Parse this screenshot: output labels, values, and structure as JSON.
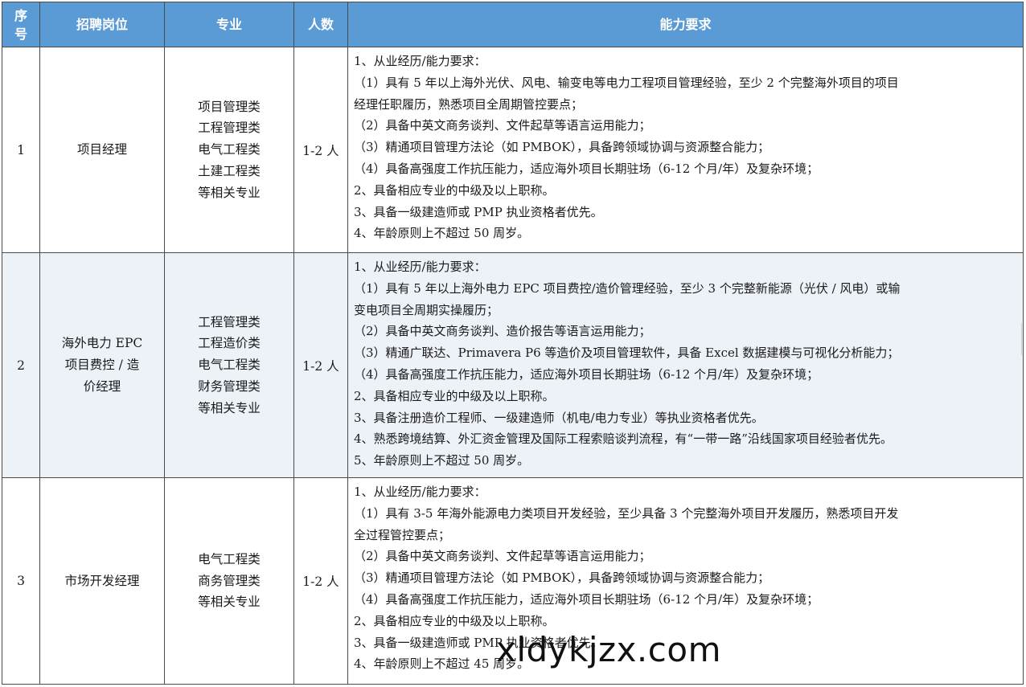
{
  "header": {
    "seq": "序\n号",
    "position": "招聘岗位",
    "major": "专业",
    "count": "人数",
    "requirements": "能力要求"
  },
  "rows": [
    {
      "seq": "1",
      "position": [
        "项目经理"
      ],
      "majors": [
        "项目管理类",
        "工程管理类",
        "电气工程类",
        "土建工程类",
        "等相关专业"
      ],
      "count": "1-2 人",
      "requirements": [
        "1、从业经历/能力要求：",
        "（1）具有 5 年以上海外光伏、风电、输变电等电力工程项目管理经验，至少 2 个完整海外项目的项目",
        "经理任职履历，熟悉项目全周期管控要点；",
        "（2）具备中英文商务谈判、文件起草等语言运用能力；",
        "（3）精通项目管理方法论（如 PMBOK），具备跨领域协调与资源整合能力；",
        "（4）具备高强度工作抗压能力，适应海外项目长期驻场（6-12 个月/年）及复杂环境；",
        "2、具备相应专业的中级及以上职称。",
        "3、具备一级建造师或 PMP 执业资格者优先。",
        "4、年龄原则上不超过 50 周岁。"
      ]
    },
    {
      "seq": "2",
      "position": [
        "海外电力 EPC",
        "项目费控 / 造",
        "价经理"
      ],
      "majors": [
        "工程管理类",
        "工程造价类",
        "电气工程类",
        "财务管理类",
        "等相关专业"
      ],
      "count": "1-2 人",
      "requirements": [
        "1、从业经历/能力要求：",
        "（1）具有 5 年以上海外电力 EPC 项目费控/造价管理经验，至少 3 个完整新能源（光伏 / 风电）或输",
        "变电项目全周期实操履历；",
        "（2）具备中英文商务谈判、造价报告等语言运用能力；",
        "（3）精通广联达、Primavera P6 等造价及项目管理软件，具备 Excel 数据建模与可视化分析能力；",
        "（4）具备高强度工作抗压能力，适应海外项目长期驻场（6-12 个月/年）及复杂环境；",
        "2、具备相应专业的中级及以上职称。",
        "3、具备注册造价工程师、一级建造师（机电/电力专业）等执业资格者优先。",
        "4、熟悉跨境结算、外汇资金管理及国际工程索赔谈判流程，有“一带一路”沿线国家项目经验者优先。",
        "5、年龄原则上不超过 50 周岁。"
      ]
    },
    {
      "seq": "3",
      "position": [
        "市场开发经理"
      ],
      "majors": [
        "电气工程类",
        "商务管理类",
        "等相关专业"
      ],
      "count": "1-2 人",
      "requirements": [
        "1、从业经历/能力要求：",
        "（1）具有 3-5 年海外能源电力类项目开发经验，至少具备 3 个完整海外项目开发履历，熟悉项目开发",
        "全过程管控要点；",
        "（2）具备中英文商务谈判、文件起草等语言运用能力；",
        "（3）精通项目管理方法论（如 PMBOK），具备跨领域协调与资源整合能力；",
        "（4）具备高强度工作抗压能力，适应海外项目长期驻场（6-12 个月/年）及复杂环境；",
        "2、具备相应专业的中级及以上职称。",
        "3、具备一级建造师或 PMP 执业资格者优先。",
        "4、年龄原则上不超过 45 周岁。"
      ]
    }
  ],
  "watermark": "xldykjzx.com"
}
